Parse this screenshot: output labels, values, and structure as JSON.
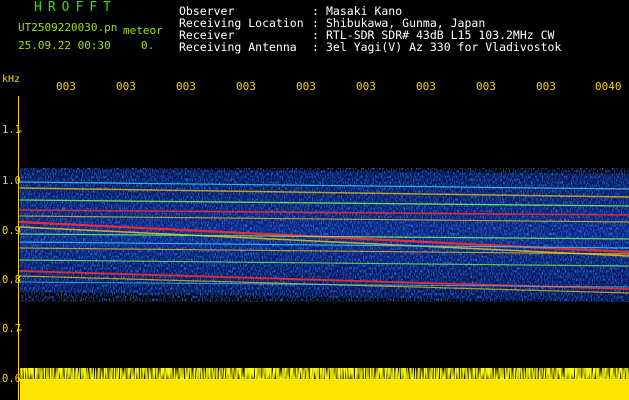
{
  "header": {
    "brand": "HROFFT",
    "file_name": "UT2509220030.pn",
    "mode": "meteor",
    "datetime": "25.09.22 00:30",
    "count": "0."
  },
  "station": [
    {
      "label": "Observer",
      "sep": ":",
      "value": "Masaki Kano"
    },
    {
      "label": "Receiving Location",
      "sep": ":",
      "value": "Shibukawa, Gunma, Japan"
    },
    {
      "label": "Receiver",
      "sep": ":",
      "value": "RTL-SDR SDR# 43dB L15 103.2MHz CW"
    },
    {
      "label": "Receiving Antenna",
      "sep": ":",
      "value": "3el Yagi(V) Az 330 for Vladivostok"
    }
  ],
  "axis": {
    "freq_unit": "kHz",
    "time_ticks": [
      "003",
      "003",
      "003",
      "003",
      "003",
      "003",
      "003",
      "003",
      "003",
      "0040"
    ],
    "freq_ticks": [
      "1.1",
      "1.0",
      "0.9",
      "0.8",
      "0.7",
      "0.6"
    ]
  },
  "colors": {
    "background": "#000000",
    "header_green": "#33e000",
    "axis_yellow": "#ffd200",
    "noise_blue": "#0b2fa8",
    "signal_red": "#ff2a2a",
    "signal_yellow": "#ffd000"
  }
}
